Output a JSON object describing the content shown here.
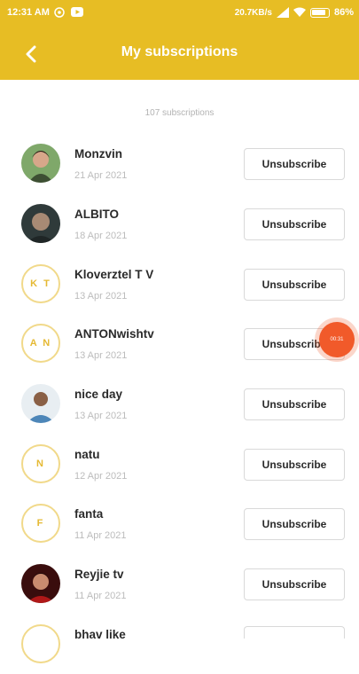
{
  "status_bar": {
    "time": "12:31 AM",
    "net_speed": "20.7KB/s",
    "battery": "86%"
  },
  "header": {
    "title": "My subscriptions"
  },
  "subscriptions_count": "107 subscriptions",
  "unsubscribe_label": "Unsubscribe",
  "items": [
    {
      "name": "Monzvin",
      "date": "21 Apr 2021",
      "avatar": "photo",
      "initials": ""
    },
    {
      "name": "ALBITO",
      "date": "18 Apr 2021",
      "avatar": "photo",
      "initials": ""
    },
    {
      "name": "Kloverztel T V",
      "date": "13 Apr 2021",
      "avatar": "initials",
      "initials": "K T"
    },
    {
      "name": "ANTONwishtv",
      "date": "13 Apr 2021",
      "avatar": "initials",
      "initials": "A N"
    },
    {
      "name": "nice day",
      "date": "13 Apr 2021",
      "avatar": "photo",
      "initials": ""
    },
    {
      "name": "natu",
      "date": "12 Apr 2021",
      "avatar": "initials",
      "initials": "N"
    },
    {
      "name": "fanta",
      "date": "11 Apr 2021",
      "avatar": "initials",
      "initials": "F"
    },
    {
      "name": "Reyjie tv",
      "date": "11 Apr 2021",
      "avatar": "photo",
      "initials": ""
    },
    {
      "name": "bhav like",
      "date": "",
      "avatar": "initials",
      "initials": ""
    }
  ],
  "recorder_timer": "00:31",
  "colors": {
    "accent": "#e7bd24",
    "initials_ring": "#f1d98a",
    "initials_text": "#e5b933",
    "recorder": "#f15a2a"
  }
}
